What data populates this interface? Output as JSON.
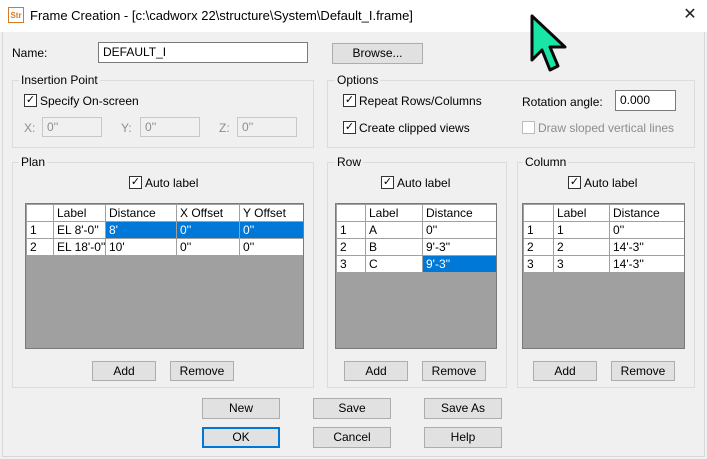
{
  "window": {
    "icon_text": "Str",
    "title": "Frame Creation - [c:\\cadworx 22\\structure\\System\\Default_I.frame]",
    "close_glyph": "✕"
  },
  "name": {
    "label": "Name:",
    "value": "DEFAULT_I",
    "browse_label": "Browse..."
  },
  "insertion_point": {
    "title": "Insertion Point",
    "specify_onscreen": {
      "label": "Specify On-screen",
      "checked": true
    },
    "x": {
      "label": "X:",
      "value": "0''"
    },
    "y": {
      "label": "Y:",
      "value": "0''"
    },
    "z": {
      "label": "Z:",
      "value": "0''"
    }
  },
  "options": {
    "title": "Options",
    "repeat_rows_columns": {
      "label": "Repeat Rows/Columns",
      "checked": true
    },
    "create_clipped_views": {
      "label": "Create clipped views",
      "checked": true
    },
    "rotation_angle": {
      "label": "Rotation angle:",
      "value": "0.000"
    },
    "draw_sloped": {
      "label": "Draw sloped vertical lines",
      "checked": false
    }
  },
  "plan": {
    "title": "Plan",
    "auto_label": {
      "label": "Auto label",
      "checked": true
    },
    "columns": [
      "",
      "Label",
      "Distance",
      "X Offset",
      "Y Offset"
    ],
    "rows": [
      [
        "1",
        "EL 8'-0''",
        "8'",
        "0''",
        "0''"
      ],
      [
        "2",
        "EL 18'-0''",
        "10'",
        "0''",
        "0''"
      ]
    ],
    "add_label": "Add",
    "remove_label": "Remove"
  },
  "row": {
    "title": "Row",
    "auto_label": {
      "label": "Auto label",
      "checked": true
    },
    "columns": [
      "",
      "Label",
      "Distance"
    ],
    "rows": [
      [
        "1",
        "A",
        "0''"
      ],
      [
        "2",
        "B",
        "9'-3''"
      ],
      [
        "3",
        "C",
        "9'-3''"
      ]
    ],
    "add_label": "Add",
    "remove_label": "Remove"
  },
  "column": {
    "title": "Column",
    "auto_label": {
      "label": "Auto label",
      "checked": true
    },
    "columns": [
      "",
      "Label",
      "Distance"
    ],
    "rows": [
      [
        "1",
        "1",
        "0''"
      ],
      [
        "2",
        "2",
        "14'-3''"
      ],
      [
        "3",
        "3",
        "14'-3''"
      ]
    ],
    "add_label": "Add",
    "remove_label": "Remove"
  },
  "buttons": {
    "new": "New",
    "save": "Save",
    "save_as": "Save As",
    "ok": "OK",
    "cancel": "Cancel",
    "help": "Help"
  },
  "check_glyph": "✓",
  "colors": {
    "accent": "#0078d7",
    "cursor": "#19e6a6"
  }
}
